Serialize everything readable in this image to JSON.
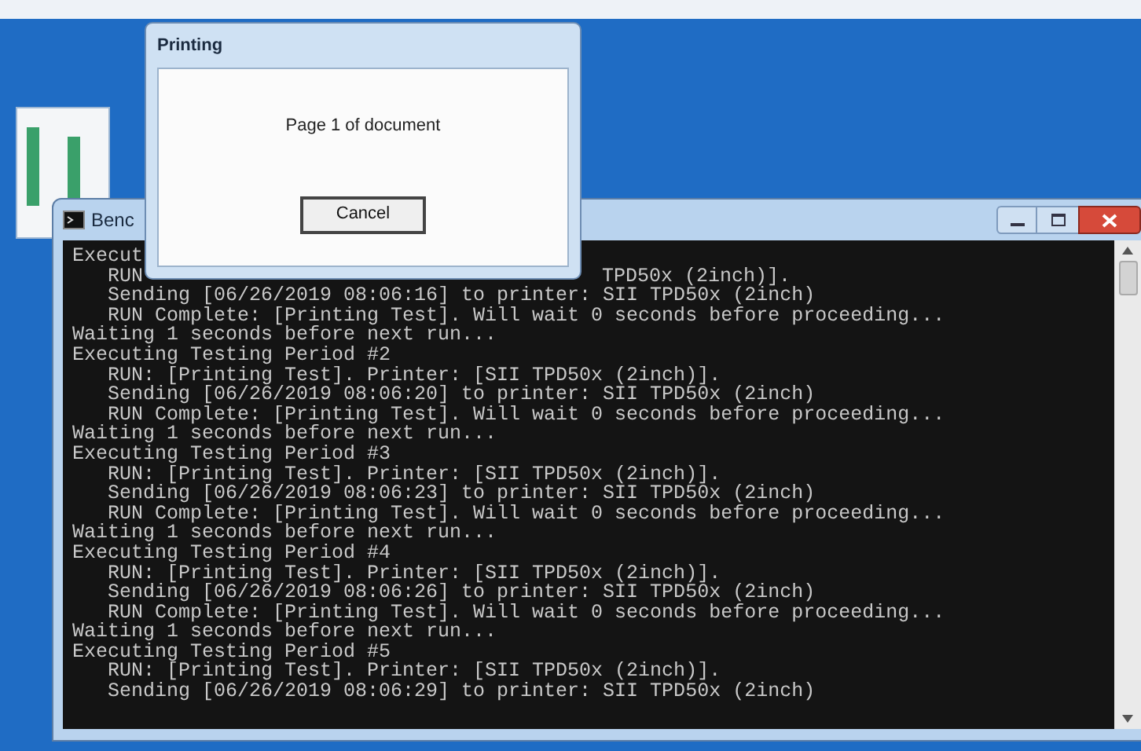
{
  "console_window": {
    "title": "Benc",
    "lines": [
      {
        "text": "Execut"
      },
      {
        "text": "   RUN",
        "tail": "TPD50x (2inch)]."
      },
      {
        "text": "   Sending [06/26/2019 08:06:16] to printer: SII TPD50x (2inch)"
      },
      {
        "text": "   RUN Complete: [Printing Test]. Will wait 0 seconds before proceeding..."
      },
      {
        "text": "Waiting 1 seconds before next run..."
      },
      {
        "text": "Executing Testing Period #2"
      },
      {
        "text": "   RUN: [Printing Test]. Printer: [SII TPD50x (2inch)]."
      },
      {
        "text": "   Sending [06/26/2019 08:06:20] to printer: SII TPD50x (2inch)"
      },
      {
        "text": "   RUN Complete: [Printing Test]. Will wait 0 seconds before proceeding..."
      },
      {
        "text": "Waiting 1 seconds before next run..."
      },
      {
        "text": "Executing Testing Period #3"
      },
      {
        "text": "   RUN: [Printing Test]. Printer: [SII TPD50x (2inch)]."
      },
      {
        "text": "   Sending [06/26/2019 08:06:23] to printer: SII TPD50x (2inch)"
      },
      {
        "text": "   RUN Complete: [Printing Test]. Will wait 0 seconds before proceeding..."
      },
      {
        "text": "Waiting 1 seconds before next run..."
      },
      {
        "text": "Executing Testing Period #4"
      },
      {
        "text": "   RUN: [Printing Test]. Printer: [SII TPD50x (2inch)]."
      },
      {
        "text": "   Sending [06/26/2019 08:06:26] to printer: SII TPD50x (2inch)"
      },
      {
        "text": "   RUN Complete: [Printing Test]. Will wait 0 seconds before proceeding..."
      },
      {
        "text": "Waiting 1 seconds before next run..."
      },
      {
        "text": "Executing Testing Period #5"
      },
      {
        "text": "   RUN: [Printing Test]. Printer: [SII TPD50x (2inch)]."
      },
      {
        "text": "   Sending [06/26/2019 08:06:29] to printer: SII TPD50x (2inch)"
      }
    ]
  },
  "printing_dialog": {
    "title": "Printing",
    "message": "Page 1 of document",
    "button": "Cancel"
  }
}
